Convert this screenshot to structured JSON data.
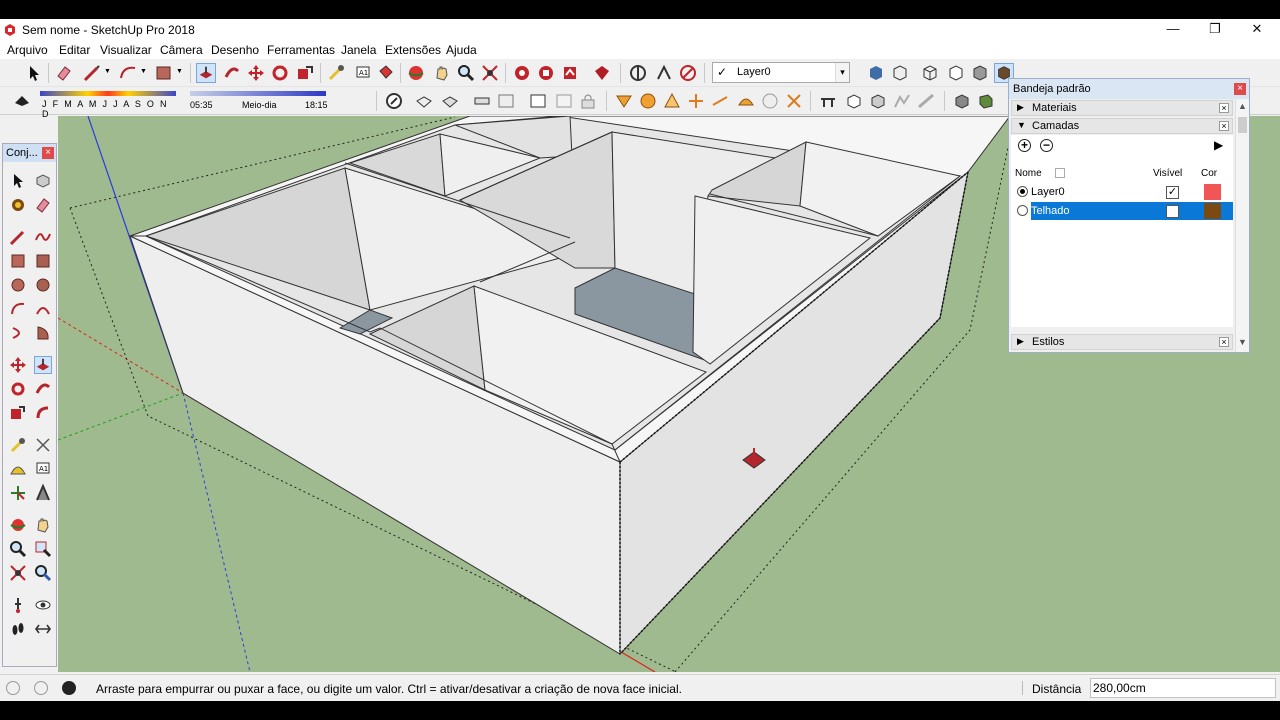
{
  "window": {
    "title": "Sem nome - SketchUp Pro 2018",
    "minimize": "—",
    "maximize": "❐",
    "close": "✕"
  },
  "menu": {
    "items": [
      "Arquivo",
      "Editar",
      "Visualizar",
      "Câmera",
      "Desenho",
      "Ferramentas",
      "Janela",
      "Extensões",
      "Ajuda"
    ]
  },
  "toolbar": {
    "layer_combo": {
      "check": "✓",
      "value": "Layer0",
      "arrow": "▾"
    },
    "shadow": {
      "months": "J F M A M J J A S O N D",
      "time_start": "05:35",
      "time_mid": "Meio-dia",
      "time_end": "18:15"
    }
  },
  "tools_panel": {
    "title": "Conj...",
    "close": "×"
  },
  "tray": {
    "title": "Bandeja padrão",
    "close": "×",
    "sections": [
      {
        "label": "Materiais",
        "arrow": "▶",
        "x": "×"
      },
      {
        "label": "Camadas",
        "arrow": "▼",
        "x": "×"
      },
      {
        "label": "Estilos",
        "arrow": "▶",
        "x": "×"
      }
    ],
    "layers": {
      "add": "+",
      "remove": "−",
      "details": "▶",
      "columns": {
        "name": "Nome",
        "visible": "Visível",
        "color": "Cor"
      },
      "rows": [
        {
          "name": "Layer0",
          "active": true,
          "visible": true,
          "visible_mark": "✓",
          "color": "#f25555"
        },
        {
          "name": "Telhado",
          "active": false,
          "visible": false,
          "visible_mark": "",
          "color": "#7a4a10"
        }
      ]
    }
  },
  "statusbar": {
    "message": "Arraste para empurrar ou puxar a face, ou digite um valor. Ctrl = ativar/desativar a criação de nova face inicial.",
    "measure_label": "Distância",
    "measure_value": "280,00cm"
  }
}
